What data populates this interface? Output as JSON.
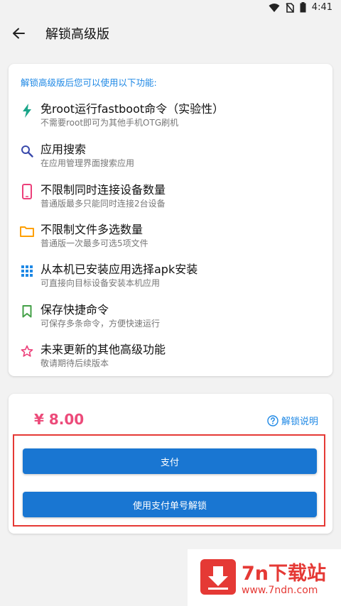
{
  "status": {
    "time": "4:41"
  },
  "appbar": {
    "title": "解锁高级版"
  },
  "features_card": {
    "intro": "解锁高级版后您可以使用以下功能:",
    "items": [
      {
        "icon": "lightning-icon",
        "color": "#1aa589",
        "title": "免root运行fastboot命令（实验性）",
        "desc": "不需要root即可为其他手机OTG刷机"
      },
      {
        "icon": "search-icon",
        "color": "#3949ab",
        "title": "应用搜索",
        "desc": "在应用管理界面搜索应用"
      },
      {
        "icon": "phone-icon",
        "color": "#ec407a",
        "title": "不限制同时连接设备数量",
        "desc": "普通版最多只能同时连接2台设备"
      },
      {
        "icon": "folder-icon",
        "color": "#ffa000",
        "title": "不限制文件多选数量",
        "desc": "普通版一次最多可选5项文件"
      },
      {
        "icon": "grid-icon",
        "color": "#1e88e5",
        "title": "从本机已安装应用选择apk安装",
        "desc": "可直接向目标设备安装本机应用"
      },
      {
        "icon": "bookmark-icon",
        "color": "#43a047",
        "title": "保存快捷命令",
        "desc": "可保存多条命令，方便快速运行"
      },
      {
        "icon": "star-icon",
        "color": "#ec407a",
        "title": "未来更新的其他高级功能",
        "desc": "敬请期待后续版本"
      }
    ]
  },
  "purchase_card": {
    "price": "¥ 8.00",
    "help_label": "解锁说明",
    "pay_label": "支付",
    "unlock_label": "使用支付单号解锁"
  },
  "watermark": {
    "title": "7n下载站",
    "url": "www.7ndn.com"
  },
  "colors": {
    "accent": "#1e88e5",
    "button": "#1976d2",
    "price": "#ec4b7a",
    "highlight_box": "#e53935"
  }
}
